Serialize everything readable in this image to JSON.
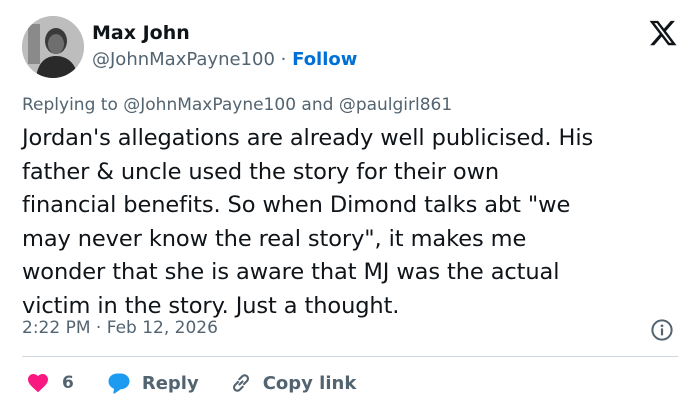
{
  "author": {
    "name": "Max John",
    "handle": "@JohnMaxPayne100",
    "separator": "·",
    "follow_label": "Follow"
  },
  "reply_context": {
    "prefix": "Replying to",
    "handle1": "@JohnMaxPayne100",
    "conjunction": "and",
    "handle2": "@paulgirl861"
  },
  "tweet": {
    "lines": [
      "Jordan's allegations are already well publicised. His",
      "father & uncle used the story for their own",
      "financial benefits. So when Dimond talks abt \"we",
      "may never know the real story\", it makes me",
      "wonder that she is aware that MJ was the actual",
      "victim in the story. Just a thought."
    ]
  },
  "meta": {
    "time": "2:22 PM",
    "separator": "·",
    "date": "Feb 12, 2026"
  },
  "actions": {
    "like_count": "6",
    "reply_label": "Reply",
    "copy_link_label": "Copy link"
  },
  "icons": {
    "platform": "x-logo-icon",
    "info": "info-icon",
    "like": "heart-icon",
    "reply": "speech-bubble-icon",
    "copy": "link-icon"
  },
  "colors": {
    "text": "#0f1419",
    "muted": "#536471",
    "link": "#006fd6",
    "like": "#f91880",
    "reply": "#1d9bf0",
    "divider": "#cfd9de"
  }
}
